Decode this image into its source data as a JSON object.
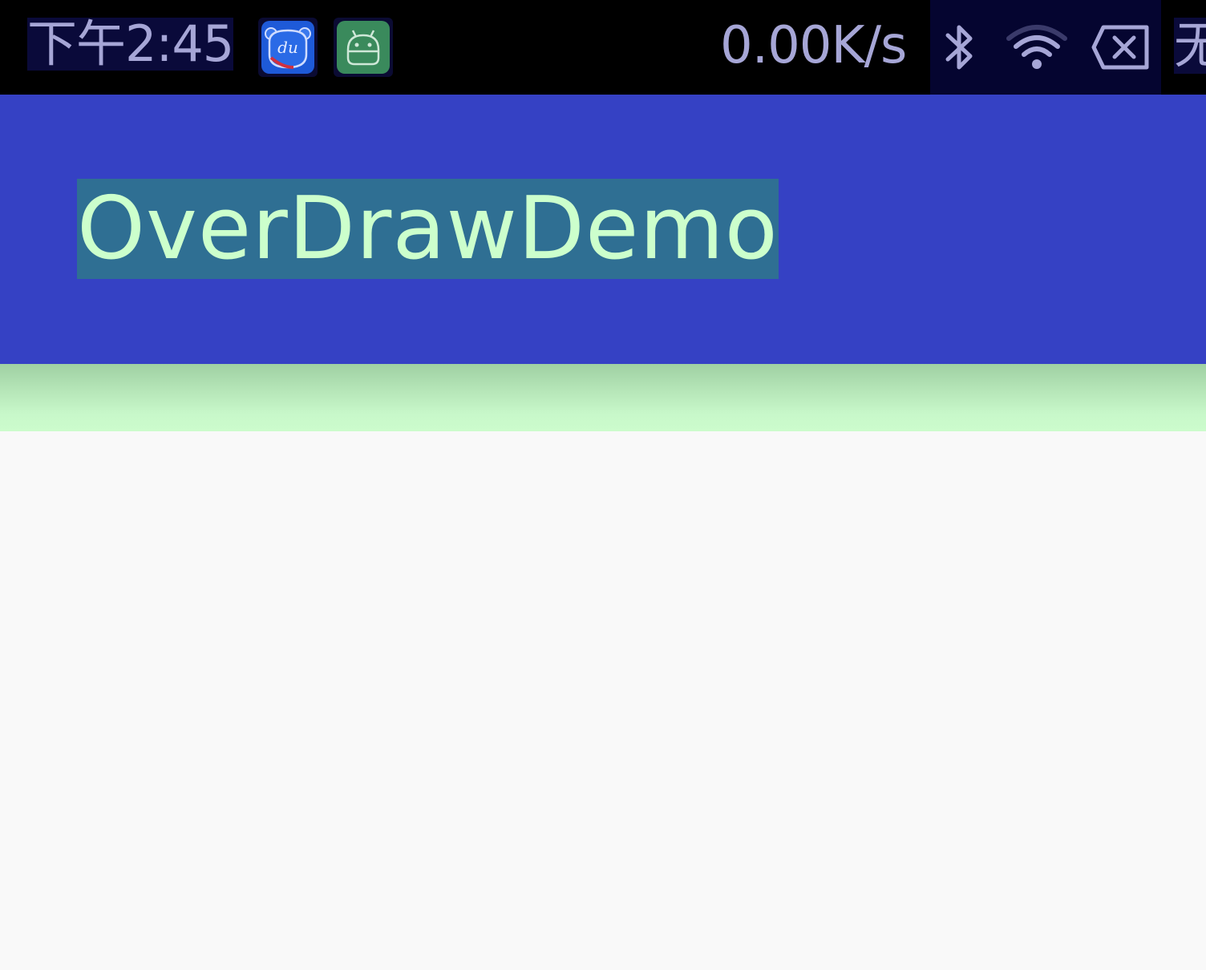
{
  "status_bar": {
    "time": "下午2:45",
    "network_speed": "0.00K/s",
    "carrier": "无",
    "notification_icons": [
      "baidu-du-icon",
      "android-icon"
    ],
    "system_icons": [
      "bluetooth-icon",
      "wifi-icon",
      "no-sim-icon"
    ]
  },
  "action_bar": {
    "title": "OverDrawDemo"
  },
  "colors": {
    "status_bar_bg": "#000000",
    "status_text": "#a6a6d6",
    "action_bar_bg": "#3541c4",
    "title_text": "#ccffcc",
    "title_highlight": "#2f6f93",
    "overdraw_band": "#ccfccc",
    "content_bg": "#f9f9f9"
  }
}
